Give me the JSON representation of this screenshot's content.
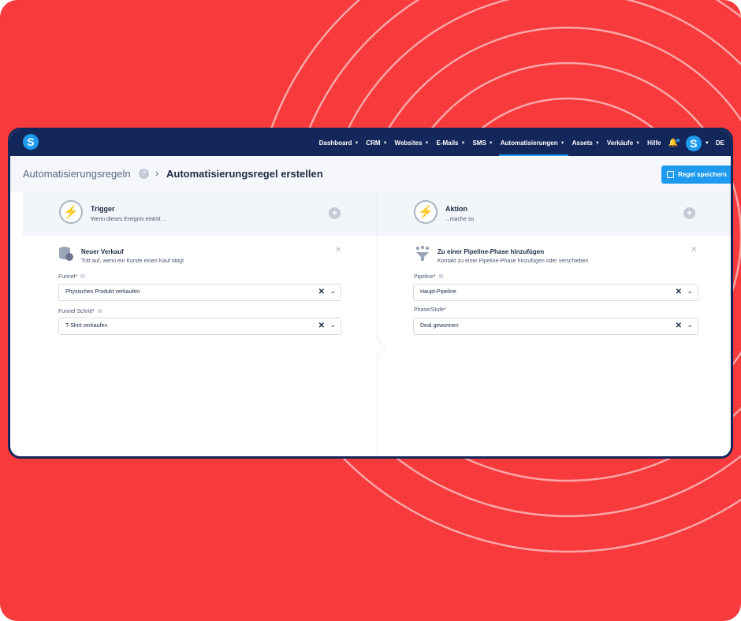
{
  "nav": {
    "items": [
      {
        "label": "Dashboard",
        "chevron": true,
        "active": false
      },
      {
        "label": "CRM",
        "chevron": true,
        "active": false
      },
      {
        "label": "Websites",
        "chevron": true,
        "active": false
      },
      {
        "label": "E-Mails",
        "chevron": true,
        "active": false
      },
      {
        "label": "SMS",
        "chevron": true,
        "active": false
      },
      {
        "label": "Automatisierungen",
        "chevron": true,
        "active": true
      },
      {
        "label": "Assets",
        "chevron": true,
        "active": false
      },
      {
        "label": "Verkäufe",
        "chevron": true,
        "active": false
      },
      {
        "label": "Hilfe",
        "chevron": false,
        "active": false
      }
    ],
    "lang": "DE",
    "logo_letter": "S",
    "avatar_letter": "S"
  },
  "breadcrumb": {
    "parent": "Automatisierungsregeln",
    "current": "Automatisierungsregel erstellen",
    "help": "?"
  },
  "save_button": {
    "label": "Regel speichern"
  },
  "trigger": {
    "title": "Trigger",
    "subtitle": "Wenn dieses Ereignis eintritt ...",
    "card_title": "Neuer Verkauf",
    "card_subtitle": "Tritt auf, wenn ein Kunde einen Kauf tätigt",
    "fields": [
      {
        "label": "Funnel*",
        "value": "Physisches Produkt verkaufen"
      },
      {
        "label": "Funnel Schritt*",
        "value": "T-Shirt verkaufen"
      }
    ]
  },
  "action": {
    "title": "Aktion",
    "subtitle": "...mache so",
    "card_title": "Zu einer Pipeline-Phase hinzufügen",
    "card_subtitle": "Kontakt zu einer Pipeline-Phase hinzufügen oder verschieben",
    "fields": [
      {
        "label": "Pipeline*",
        "value": "Haupt-Pipeline"
      },
      {
        "label": "Phase/Stufe*",
        "value": "Deal gewonnen"
      }
    ]
  },
  "colors": {
    "background": "#f73a3c",
    "navbar": "#14275a",
    "accent": "#1e9bf0"
  },
  "icons": [
    "lightning-icon",
    "plus-icon",
    "close-icon",
    "chevron-down-icon",
    "bell-icon",
    "save-icon",
    "external-link-icon",
    "coins-icon",
    "funnel-icon"
  ]
}
